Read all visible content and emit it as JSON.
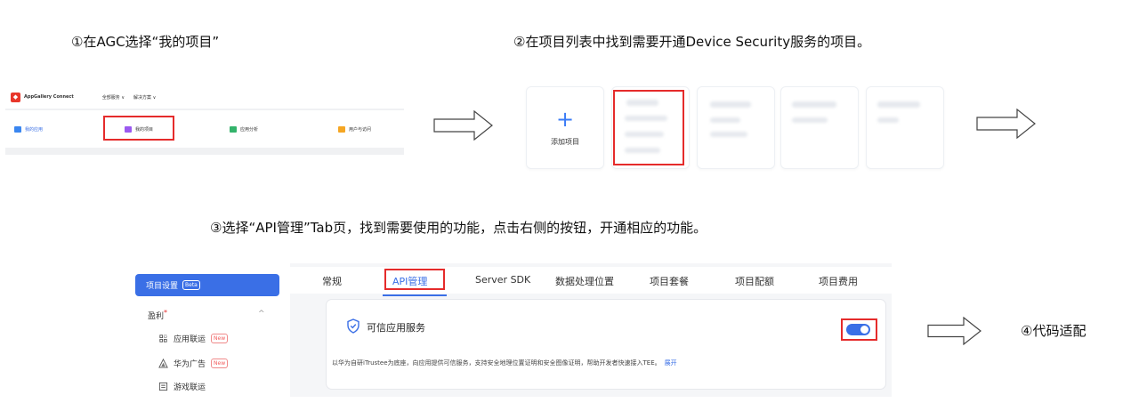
{
  "steps": {
    "step1": "①在AGC选择“我的项目”",
    "step2": "②在项目列表中找到需要开通Device Security服务的项目。",
    "step3": "③选择“API管理”Tab页，找到需要使用的功能，点击右侧的按钮，开通相应的功能。",
    "step4": "④代码适配"
  },
  "agc": {
    "brand": "AppGallery Connect",
    "menu_all_services": "全部服务 ∨",
    "menu_solutions": "解决方案 ∨",
    "items": [
      {
        "label": "我的应用",
        "icon": "apps-icon",
        "color": "#3a86f0"
      },
      {
        "label": "我的项目",
        "icon": "projects-icon",
        "color": "#9b59f0"
      },
      {
        "label": "应用分析",
        "icon": "analytics-icon",
        "color": "#33b36b"
      },
      {
        "label": "用户与访问",
        "icon": "user-access-icon",
        "color": "#f5a623"
      }
    ]
  },
  "project_list": {
    "add_label": "添加项目",
    "add_icon": "plus-icon"
  },
  "settings": {
    "sidebar": {
      "active_label": "项目设置",
      "active_badge": "Beta",
      "group_label": "盈利",
      "group_dot": "*",
      "group_chevron": "^",
      "items": [
        {
          "label": "应用联运",
          "badge": "New",
          "icon": "app-union-icon"
        },
        {
          "label": "华为广告",
          "badge": "New",
          "icon": "ads-icon"
        },
        {
          "label": "游戏联运",
          "badge": "",
          "icon": "game-union-icon"
        }
      ]
    },
    "tabs": [
      "常规",
      "API管理",
      "Server SDK",
      "数据处理位置",
      "项目套餐",
      "项目配额",
      "项目费用"
    ],
    "active_tab": "API管理",
    "service": {
      "title": "可信应用服务",
      "description": "以华为自研iTrustee为底座，向应用提供可信服务，支持安全地理位置证明和安全图像证明，帮助开发者快速接入TEE。",
      "expand_link": "展开",
      "toggle_on": true,
      "icon": "shield-check-icon"
    }
  },
  "colors": {
    "accent": "#3a6fe6",
    "highlight": "#e52b2b",
    "brand_red": "#e8372b"
  }
}
